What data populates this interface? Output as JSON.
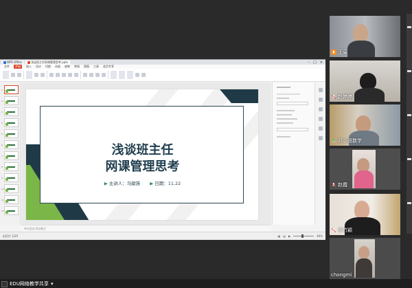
{
  "browser_tabs": [
    {
      "label": "WPS Office",
      "active": false,
      "icon": "wps-icon"
    },
    {
      "label": "浅谈班主任网课管理思考.pptx",
      "active": true,
      "icon": "ppt-icon"
    }
  ],
  "menu": {
    "start_label": "开始",
    "items": [
      "文件",
      "开始",
      "插入",
      "设计",
      "切换",
      "动画",
      "放映",
      "审阅",
      "视图",
      "工具",
      "会员专享"
    ]
  },
  "slide": {
    "title_line1": "浅谈班主任",
    "title_line2": "网课管理思考",
    "presenter": "主讲人：马献族",
    "date": "日期：11.22"
  },
  "notes_placeholder": "单击此处添加备注",
  "status": {
    "slide_info": "幻灯片 1/25",
    "zoom": "46%"
  },
  "participants": [
    {
      "name": "王朵",
      "muted": false
    },
    {
      "name": "赵婷婷",
      "muted": true
    },
    {
      "name": "邓小语数学",
      "muted": false
    },
    {
      "name": "赵霞",
      "muted": true
    },
    {
      "name": "王竹颖",
      "muted": true
    },
    {
      "name": "chongmi",
      "muted": true
    }
  ],
  "bottom": {
    "label": "EDU网络教学共享"
  },
  "colors": {
    "accent": "#d9482b",
    "slide_dark": "#1f3a46",
    "slide_green": "#7ab648",
    "title": "#1f3e4e"
  }
}
